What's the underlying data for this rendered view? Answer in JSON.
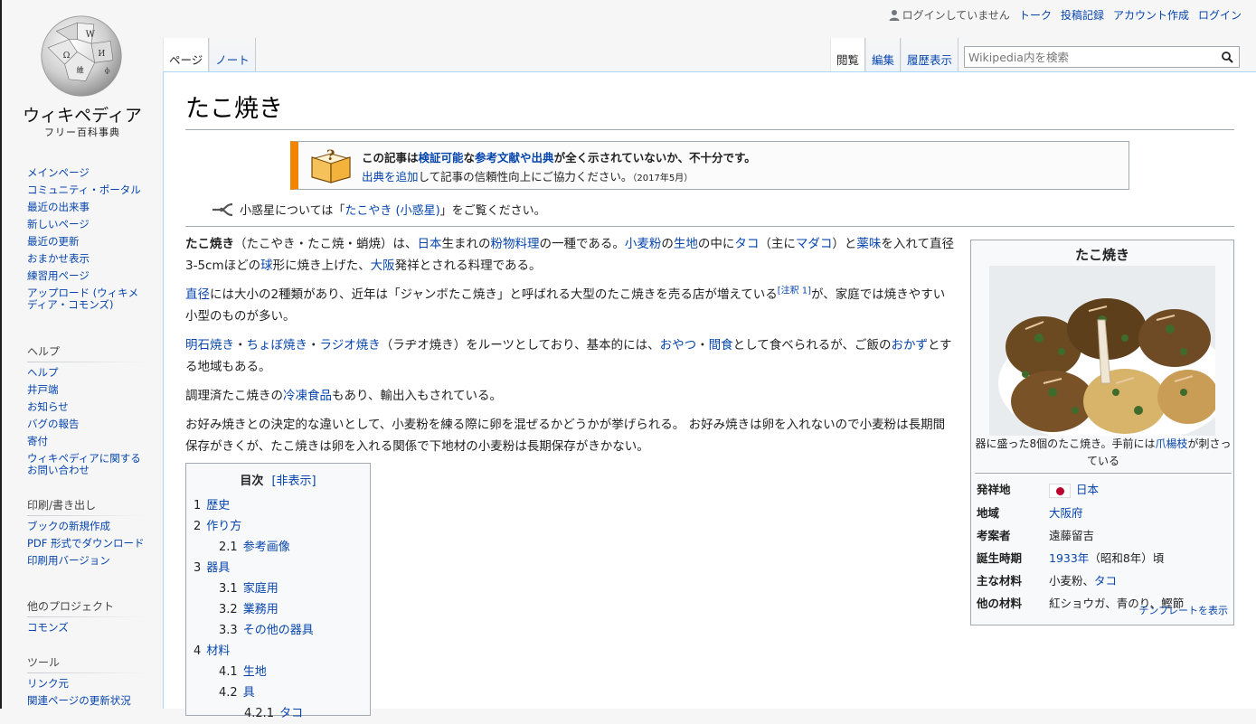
{
  "logo": {
    "title": "ウィキペディア",
    "subtitle": "フリー百科事典"
  },
  "personal": {
    "anon": "ログインしていません",
    "talk": "トーク",
    "contribs": "投稿記録",
    "create_account": "アカウント作成",
    "login": "ログイン"
  },
  "tabs": {
    "page": "ページ",
    "note": "ノート",
    "read": "閲覧",
    "edit": "編集",
    "history": "履歴表示"
  },
  "search": {
    "placeholder": "Wikipedia内を検索"
  },
  "sidebar": {
    "nav": [
      "メインページ",
      "コミュニティ・ポータル",
      "最近の出来事",
      "新しいページ",
      "最近の更新",
      "おまかせ表示",
      "練習用ページ",
      "アップロード (ウィキメディア・コモンズ)"
    ],
    "help_head": "ヘルプ",
    "help": [
      "ヘルプ",
      "井戸端",
      "お知らせ",
      "バグの報告",
      "寄付",
      "ウィキペディアに関するお問い合わせ"
    ],
    "print_head": "印刷/書き出し",
    "print": [
      "ブックの新規作成",
      "PDF 形式でダウンロード",
      "印刷用バージョン"
    ],
    "other_head": "他のプロジェクト",
    "other": [
      "コモンズ"
    ],
    "tools_head": "ツール",
    "tools": [
      "リンク元",
      "関連ページの更新状況"
    ]
  },
  "article": {
    "title": "たこ焼き",
    "ambox": {
      "line1_a": "この記事は",
      "line1_link1": "検証可能",
      "line1_b": "な",
      "line1_link2": "参考文献や出典",
      "line1_c": "が全く示されていないか、不十分です。",
      "line2_link": "出典を追加",
      "line2_text": "して記事の信頼性向上にご協力ください。",
      "date": "（2017年5月）"
    },
    "hatnote": {
      "pre": "小惑星については「",
      "link": "たこやき (小惑星)",
      "post": "」をご覧ください。"
    },
    "p1": {
      "bold": "たこ焼き",
      "t1": "（たこやき・たこ焼・蛸焼）は、",
      "l1": "日本",
      "t2": "生まれの",
      "l2": "粉物料理",
      "t3": "の一種である。",
      "l3": "小麦粉",
      "t4": "の",
      "l4": "生地",
      "t5": "の中に",
      "l5": "タコ",
      "t6": "（主に",
      "l6": "マダコ",
      "t7": "）と",
      "l7": "薬味",
      "t8": "を入れて直径 3-5cmほどの",
      "l8": "球",
      "t9": "形に焼き上げた、",
      "l9": "大阪",
      "t10": "発祥とされる料理である。"
    },
    "p2": {
      "l1": "直径",
      "t1": "には大小の2種類があり、近年は「ジャンボたこ焼き」と呼ばれる大型のたこ焼きを売る店が増えている",
      "ref": "[注釈 1]",
      "t2": "が、家庭では焼きやすい小型のものが多い。"
    },
    "p3": {
      "l1": "明石焼き",
      "t1": "・",
      "l2": "ちょぼ焼き",
      "t2": "・",
      "l3": "ラジオ焼き",
      "t3": "（ラヂオ焼き）をルーツとしており、基本的には、",
      "l4": "おやつ",
      "t4": "・",
      "l5": "間食",
      "t5": "として食べられるが、ご飯の",
      "l6": "おかず",
      "t6": "とする地域もある。"
    },
    "p4": {
      "t1": "調理済たこ焼きの",
      "l1": "冷凍食品",
      "t2": "もあり、輸出入もされている。"
    },
    "p5": "お好み焼きとの決定的な違いとして、小麦粉を練る際に卵を混ぜるかどうかが挙げられる。 お好み焼きは卵を入れないので小麦粉は長期間保存がきくが、たこ焼きは卵を入れる関係で下地材の小麦粉は長期保存がきかない。"
  },
  "toc": {
    "title": "目次",
    "toggle": "[非表示]",
    "items": [
      {
        "num": "1",
        "label": "歴史"
      },
      {
        "num": "2",
        "label": "作り方"
      },
      {
        "num": "2.1",
        "label": "参考画像"
      },
      {
        "num": "3",
        "label": "器具"
      },
      {
        "num": "3.1",
        "label": "家庭用"
      },
      {
        "num": "3.2",
        "label": "業務用"
      },
      {
        "num": "3.3",
        "label": "その他の器具"
      },
      {
        "num": "4",
        "label": "材料"
      },
      {
        "num": "4.1",
        "label": "生地"
      },
      {
        "num": "4.2",
        "label": "具"
      },
      {
        "num": "4.2.1",
        "label": "タコ"
      }
    ]
  },
  "infobox": {
    "title": "たこ焼き",
    "caption_a": "器に盛った8個のたこ焼き。手前には",
    "caption_link": "爪楊枝",
    "caption_b": "が刺さっている",
    "rows": [
      {
        "key": "発祥地",
        "value": "日本"
      },
      {
        "key": "地域",
        "value": "大阪府"
      },
      {
        "key": "考案者",
        "value": "遠藤留吉"
      },
      {
        "key": "誕生時期",
        "value_link": "1933年",
        "value_rest": "（昭和8年）頃"
      },
      {
        "key": "主な材料",
        "value_a": "小麦粉、",
        "value_link": "タコ"
      },
      {
        "key": "他の材料",
        "value": "紅ショウガ、青のり、鰹節"
      }
    ],
    "footer": "テンプレートを表示"
  }
}
